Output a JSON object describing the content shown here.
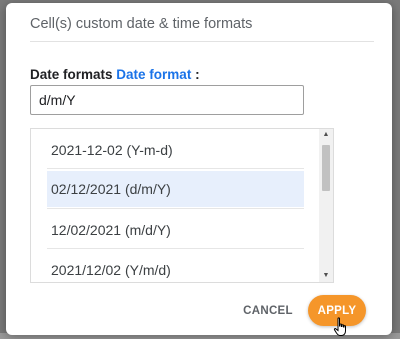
{
  "dialog": {
    "title": "Cell(s) custom date & time formats",
    "label_prefix": "Date formats",
    "label_link": "Date format",
    "label_suffix": ":",
    "input_value": "d/m/Y",
    "formats": [
      {
        "label": "2021-12-02 (Y-m-d)",
        "selected": false
      },
      {
        "label": "02/12/2021 (d/m/Y)",
        "selected": true
      },
      {
        "label": "12/02/2021 (m/d/Y)",
        "selected": false
      },
      {
        "label": "2021/12/02 (Y/m/d)",
        "selected": false
      }
    ],
    "cancel_label": "CANCEL",
    "apply_label": "APPLY",
    "accent_color": "#f5962a",
    "selection_color": "#e7effc",
    "link_color": "#1a73e8"
  },
  "icons": {
    "scroll_up": "triangle-up-icon",
    "scroll_down": "triangle-down-icon",
    "cursor": "hand-pointer-icon"
  }
}
